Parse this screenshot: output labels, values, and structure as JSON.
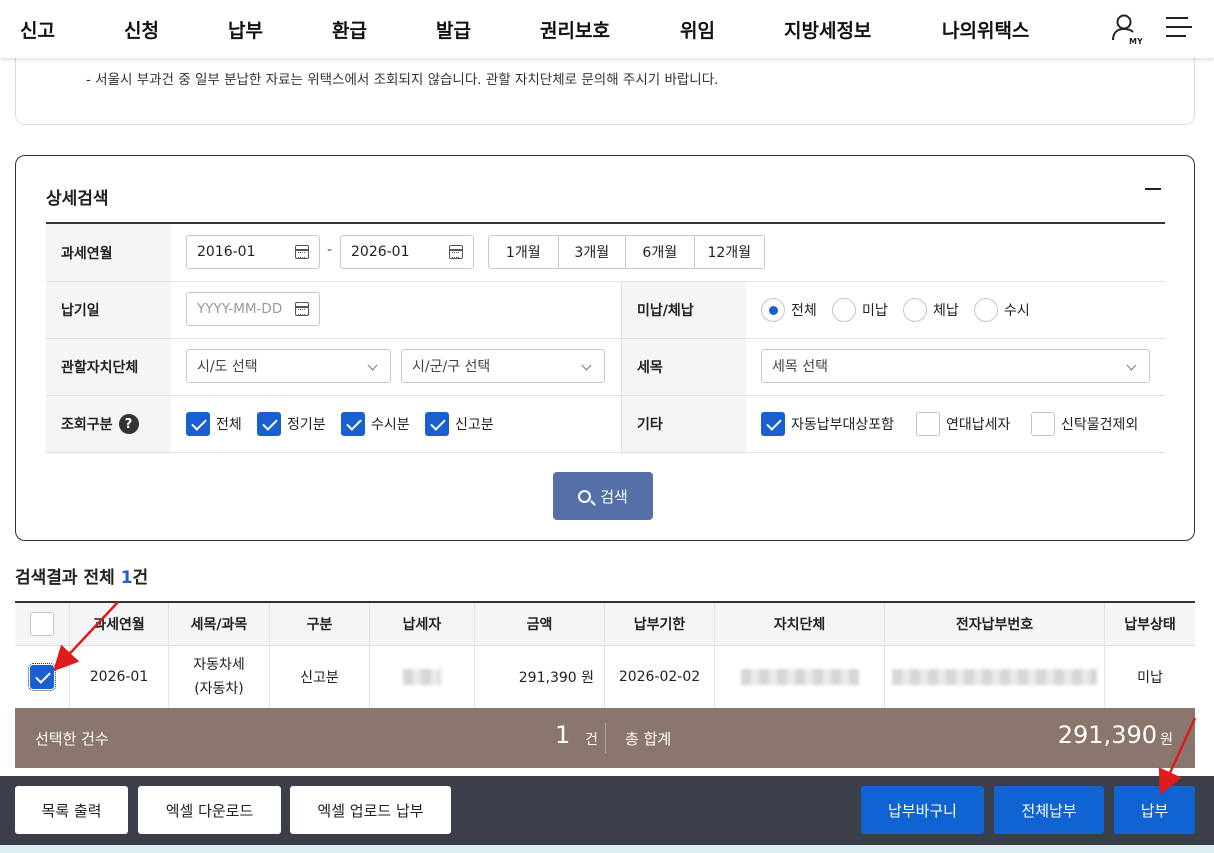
{
  "nav": {
    "items": [
      "신고",
      "신청",
      "납부",
      "환급",
      "발급",
      "권리보호",
      "위임",
      "지방세정보",
      "나의위택스"
    ],
    "my_label": "MY"
  },
  "notice": {
    "text": "- 서울시 부과건 중 일부 분납한 자료는 위택스에서 조회되지 않습니다. 관할 자치단체로 문의해 주시기 바랍니다."
  },
  "search": {
    "title": "상세검색",
    "tax_period_label": "과세연월",
    "date_from": "2016-01",
    "date_sep": "-",
    "date_to": "2026-01",
    "period_buttons": [
      "1개월",
      "3개월",
      "6개월",
      "12개월"
    ],
    "due_date_label": "납기일",
    "due_date_placeholder": "YYYY-MM-DD",
    "unpaid_label": "미납/체납",
    "unpaid_options": [
      "전체",
      "미납",
      "체납",
      "수시"
    ],
    "unpaid_selected": "전체",
    "authority_label": "관할자치단체",
    "sido_placeholder": "시/도 선택",
    "sigungu_placeholder": "시/군/구 선택",
    "tax_item_label": "세목",
    "tax_item_placeholder": "세목 선택",
    "query_type_label": "조회구분",
    "query_types": [
      {
        "label": "전체",
        "checked": true
      },
      {
        "label": "정기분",
        "checked": true
      },
      {
        "label": "수시분",
        "checked": true
      },
      {
        "label": "신고분",
        "checked": true
      }
    ],
    "etc_label": "기타",
    "etc_options": [
      {
        "label": "자동납부대상포함",
        "checked": true
      },
      {
        "label": "연대납세자",
        "checked": false
      },
      {
        "label": "신탁물건제외",
        "checked": false
      }
    ],
    "search_button": "검색"
  },
  "results": {
    "title_prefix": "검색결과 전체 ",
    "count": "1",
    "title_suffix": "건",
    "headers": [
      "과세연월",
      "세목/과목",
      "구분",
      "납세자",
      "금액",
      "납부기한",
      "자치단체",
      "전자납부번호",
      "납부상태"
    ],
    "rows": [
      {
        "checked": true,
        "period": "2026-01",
        "tax_item_line1": "자동차세",
        "tax_item_line2": "(자동차)",
        "type": "신고분",
        "amount": "291,390 원",
        "due_date": "2026-02-02",
        "status": "미납"
      }
    ]
  },
  "summary": {
    "selected_label": "선택한 건수",
    "selected_count": "1",
    "count_unit": "건",
    "total_label": "총 합계",
    "total_amount": "291,390",
    "amount_unit": "원"
  },
  "actions": {
    "print_list": "목록 출력",
    "excel_download": "엑셀 다운로드",
    "excel_upload_pay": "엑셀 업로드 납부",
    "cart": "납부바구니",
    "pay_all": "전체납부",
    "pay": "납부"
  },
  "colors": {
    "primary_blue": "#1063d3",
    "search_button": "#5470a7",
    "summary_bar": "#8a766c",
    "bottom_bar": "#3b3f4a",
    "annotation_arrow": "#e01b1b"
  }
}
